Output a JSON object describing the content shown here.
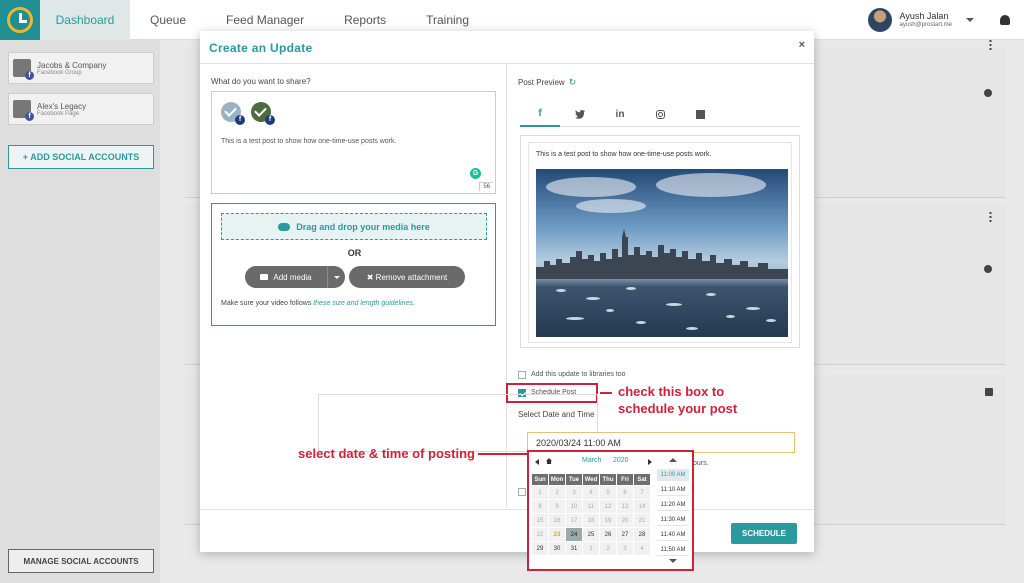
{
  "nav": {
    "items": [
      "Dashboard",
      "Queue",
      "Feed Manager",
      "Reports",
      "Training"
    ],
    "active": "Dashboard",
    "user_name": "Ayush Jalan",
    "user_email": "ayush@prostart.me"
  },
  "sidebar": {
    "accounts": [
      {
        "name": "Jacobs & Company",
        "type": "Facebook Group"
      },
      {
        "name": "Alex's Legacy",
        "type": "Facebook Page"
      }
    ],
    "add_social_label": "+ ADD SOCIAL ACCOUNTS",
    "manage_social_label": "MANAGE SOCIAL ACCOUNTS"
  },
  "modal": {
    "title": "Create an Update",
    "close": "×",
    "compose_label": "What do you want to share?",
    "compose_text": "This is a test post to show how one-time-use posts work.",
    "char_count": "56",
    "drop_label": "Drag and drop your media here",
    "or_label": "OR",
    "add_media_label": "Add media",
    "remove_attachment_label": "✖ Remove attachment",
    "media_note_prefix": "Make sure your video follows ",
    "media_note_link": "these size and length guidelines",
    "media_note_suffix": ".",
    "preview_label": "Post Preview",
    "preview_tabs": [
      "f",
      "t",
      "in",
      "ig",
      "gmb"
    ],
    "preview_text": "This is a test post to show how one-time-use posts work.",
    "library_check_label": "Add this update to libraries too",
    "schedule_check_label": "Schedule Post",
    "schedule_checked": true,
    "date_section_label": "Select Date and Time",
    "date_value": "2020/03/24 11:00 AM",
    "hours_note": "ours.",
    "schedule_button": "SCHEDULE"
  },
  "annotations": {
    "schedule_callout_line1": "check this box to",
    "schedule_callout_line2": "schedule your post",
    "date_callout": "select date & time of posting",
    "color": "#d0213a"
  },
  "datepicker": {
    "month": "March",
    "year": "2020",
    "weekdays": [
      "Sun",
      "Mon",
      "Tue",
      "Wed",
      "Thu",
      "Fri",
      "Sat"
    ],
    "weeks": [
      [
        "1",
        "2",
        "3",
        "4",
        "5",
        "6",
        "7"
      ],
      [
        "8",
        "9",
        "10",
        "11",
        "12",
        "13",
        "14"
      ],
      [
        "15",
        "16",
        "17",
        "18",
        "19",
        "20",
        "21"
      ],
      [
        "22",
        "23",
        "24",
        "25",
        "26",
        "27",
        "28"
      ],
      [
        "29",
        "30",
        "31",
        "1",
        "2",
        "3",
        "4"
      ]
    ],
    "today": "23",
    "selected": "24",
    "times": [
      "11:00 AM",
      "11:10 AM",
      "11:20 AM",
      "11:30 AM",
      "11:40 AM",
      "11:50 AM"
    ],
    "selected_time": "11:00 AM"
  },
  "colors": {
    "brand": "#2a9a9e",
    "annotation": "#d0213a"
  }
}
